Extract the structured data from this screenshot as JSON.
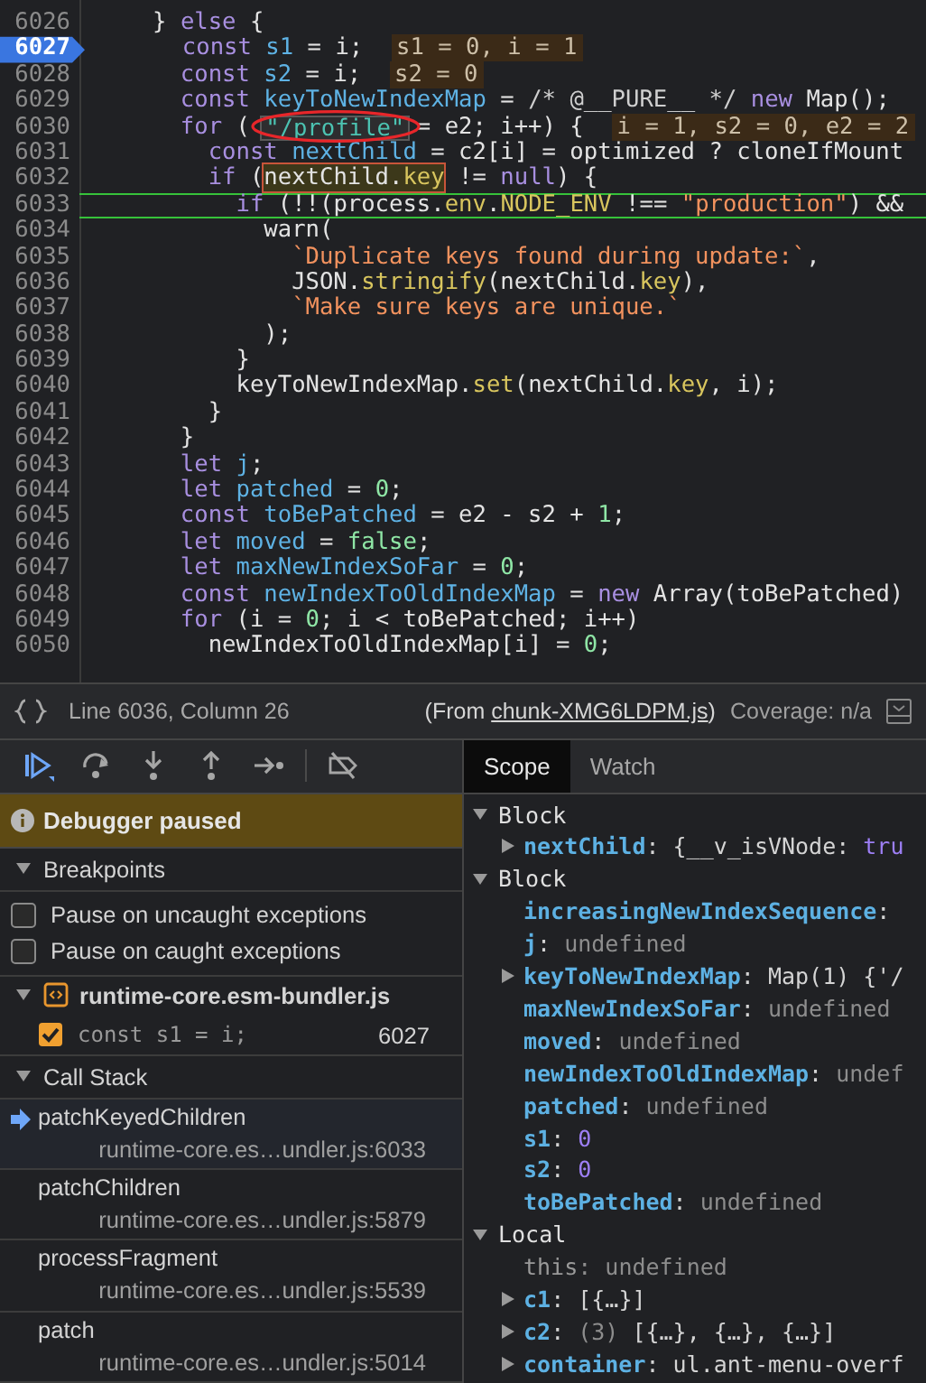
{
  "editor": {
    "lines": [
      {
        "number": "6026",
        "breakpoint": false,
        "current": false,
        "tokens": [
          {
            "text": "     } ",
            "kind": "plain"
          },
          {
            "text": "else",
            "kind": "keyword"
          },
          {
            "text": " {",
            "kind": "plain"
          }
        ]
      },
      {
        "number": "6027",
        "breakpoint": true,
        "current": false,
        "tokens": [
          {
            "text": "       const ",
            "kind": "keyword"
          },
          {
            "text": "s1",
            "kind": "definition"
          },
          {
            "text": " = i;  ",
            "kind": "plain"
          },
          {
            "text": "s1 = 0, i = 1",
            "kind": "inline-value"
          }
        ]
      },
      {
        "number": "6028",
        "breakpoint": false,
        "current": false,
        "tokens": [
          {
            "text": "       const ",
            "kind": "keyword"
          },
          {
            "text": "s2",
            "kind": "definition"
          },
          {
            "text": " = i;  ",
            "kind": "plain"
          },
          {
            "text": "s2 = 0",
            "kind": "inline-value"
          }
        ]
      },
      {
        "number": "6029",
        "breakpoint": false,
        "current": false,
        "tokens": [
          {
            "text": "       const ",
            "kind": "keyword"
          },
          {
            "text": "keyToNewIndexMap",
            "kind": "definition"
          },
          {
            "text": " = ",
            "kind": "plain"
          },
          {
            "text": "/* @__PURE__ */ ",
            "kind": "comment"
          },
          {
            "text": "new",
            "kind": "keyword"
          },
          {
            "text": " Map();",
            "kind": "plain"
          }
        ]
      },
      {
        "number": "6030",
        "breakpoint": false,
        "current": false,
        "tokens": [
          {
            "text": "       for",
            "kind": "keyword"
          },
          {
            "text": " (            = e2; i++) {  ",
            "kind": "plain"
          },
          {
            "text": "i = 1, s2 = 0, e2 = 2",
            "kind": "inline-value"
          }
        ]
      },
      {
        "number": "6031",
        "breakpoint": false,
        "current": false,
        "tokens": [
          {
            "text": "         const ",
            "kind": "keyword"
          },
          {
            "text": "nextChild",
            "kind": "definition"
          },
          {
            "text": " = c2[i] = optimized ? cloneIfMount",
            "kind": "plain"
          }
        ]
      },
      {
        "number": "6032",
        "breakpoint": false,
        "current": false,
        "tokens": [
          {
            "text": "         if",
            "kind": "keyword"
          },
          {
            "text": " (",
            "kind": "plain"
          },
          {
            "kind": "hover",
            "tokens": [
              {
                "text": "nextChild.",
                "kind": "plain"
              },
              {
                "text": "key",
                "kind": "property"
              }
            ]
          },
          {
            "text": " != ",
            "kind": "plain"
          },
          {
            "text": "null",
            "kind": "keyword"
          },
          {
            "text": ") {",
            "kind": "plain"
          }
        ]
      },
      {
        "number": "6033",
        "breakpoint": false,
        "current": true,
        "tokens": [
          {
            "text": "           if",
            "kind": "keyword"
          },
          {
            "text": " (!!(process.",
            "kind": "plain"
          },
          {
            "text": "env",
            "kind": "property"
          },
          {
            "text": ".",
            "kind": "plain"
          },
          {
            "text": "NODE_ENV",
            "kind": "property"
          },
          {
            "text": " !== ",
            "kind": "plain"
          },
          {
            "text": "\"production\"",
            "kind": "string"
          },
          {
            "text": ") &&",
            "kind": "plain"
          }
        ]
      },
      {
        "number": "6034",
        "breakpoint": false,
        "current": false,
        "tokens": [
          {
            "text": "             warn(",
            "kind": "plain"
          }
        ]
      },
      {
        "number": "6035",
        "breakpoint": false,
        "current": false,
        "tokens": [
          {
            "text": "               `Duplicate keys found during update:`",
            "kind": "string"
          },
          {
            "text": ",",
            "kind": "plain"
          }
        ]
      },
      {
        "number": "6036",
        "breakpoint": false,
        "current": false,
        "tokens": [
          {
            "text": "               JSON.",
            "kind": "plain"
          },
          {
            "text": "stringify",
            "kind": "property"
          },
          {
            "text": "(nextChild.",
            "kind": "plain"
          },
          {
            "text": "key",
            "kind": "property"
          },
          {
            "text": "),",
            "kind": "plain"
          }
        ]
      },
      {
        "number": "6037",
        "breakpoint": false,
        "current": false,
        "tokens": [
          {
            "text": "               `Make sure keys are unique.`",
            "kind": "string"
          }
        ]
      },
      {
        "number": "6038",
        "breakpoint": false,
        "current": false,
        "tokens": [
          {
            "text": "             );",
            "kind": "plain"
          }
        ]
      },
      {
        "number": "6039",
        "breakpoint": false,
        "current": false,
        "tokens": [
          {
            "text": "           }",
            "kind": "plain"
          }
        ]
      },
      {
        "number": "6040",
        "breakpoint": false,
        "current": false,
        "tokens": [
          {
            "text": "           keyToNewIndexMap.",
            "kind": "plain"
          },
          {
            "text": "set",
            "kind": "property"
          },
          {
            "text": "(nextChild.",
            "kind": "plain"
          },
          {
            "text": "key",
            "kind": "property"
          },
          {
            "text": ", i);",
            "kind": "plain"
          }
        ]
      },
      {
        "number": "6041",
        "breakpoint": false,
        "current": false,
        "tokens": [
          {
            "text": "         }",
            "kind": "plain"
          }
        ]
      },
      {
        "number": "6042",
        "breakpoint": false,
        "current": false,
        "tokens": [
          {
            "text": "       }",
            "kind": "plain"
          }
        ]
      },
      {
        "number": "6043",
        "breakpoint": false,
        "current": false,
        "tokens": [
          {
            "text": "       let ",
            "kind": "keyword"
          },
          {
            "text": "j",
            "kind": "definition"
          },
          {
            "text": ";",
            "kind": "plain"
          }
        ]
      },
      {
        "number": "6044",
        "breakpoint": false,
        "current": false,
        "tokens": [
          {
            "text": "       let ",
            "kind": "keyword"
          },
          {
            "text": "patched",
            "kind": "definition"
          },
          {
            "text": " = ",
            "kind": "plain"
          },
          {
            "text": "0",
            "kind": "number"
          },
          {
            "text": ";",
            "kind": "plain"
          }
        ]
      },
      {
        "number": "6045",
        "breakpoint": false,
        "current": false,
        "tokens": [
          {
            "text": "       const ",
            "kind": "keyword"
          },
          {
            "text": "toBePatched",
            "kind": "definition"
          },
          {
            "text": " = e2 - s2 + ",
            "kind": "plain"
          },
          {
            "text": "1",
            "kind": "number"
          },
          {
            "text": ";",
            "kind": "plain"
          }
        ]
      },
      {
        "number": "6046",
        "breakpoint": false,
        "current": false,
        "tokens": [
          {
            "text": "       let ",
            "kind": "keyword"
          },
          {
            "text": "moved",
            "kind": "definition"
          },
          {
            "text": " = ",
            "kind": "plain"
          },
          {
            "text": "false",
            "kind": "number"
          },
          {
            "text": ";",
            "kind": "plain"
          }
        ]
      },
      {
        "number": "6047",
        "breakpoint": false,
        "current": false,
        "tokens": [
          {
            "text": "       let ",
            "kind": "keyword"
          },
          {
            "text": "maxNewIndexSoFar",
            "kind": "definition"
          },
          {
            "text": " = ",
            "kind": "plain"
          },
          {
            "text": "0",
            "kind": "number"
          },
          {
            "text": ";",
            "kind": "plain"
          }
        ]
      },
      {
        "number": "6048",
        "breakpoint": false,
        "current": false,
        "tokens": [
          {
            "text": "       const ",
            "kind": "keyword"
          },
          {
            "text": "newIndexToOldIndexMap",
            "kind": "definition"
          },
          {
            "text": " = ",
            "kind": "plain"
          },
          {
            "text": "new",
            "kind": "keyword"
          },
          {
            "text": " Array(toBePatched)",
            "kind": "plain"
          }
        ]
      },
      {
        "number": "6049",
        "breakpoint": false,
        "current": false,
        "tokens": [
          {
            "text": "       for",
            "kind": "keyword"
          },
          {
            "text": " (i = ",
            "kind": "plain"
          },
          {
            "text": "0",
            "kind": "number"
          },
          {
            "text": "; i < toBePatched; i++)",
            "kind": "plain"
          }
        ]
      },
      {
        "number": "6050",
        "breakpoint": false,
        "current": false,
        "tokens": [
          {
            "text": "         newIndexToOldIndexMap[i] = ",
            "kind": "plain"
          },
          {
            "text": "0",
            "kind": "number"
          },
          {
            "text": ";",
            "kind": "plain"
          }
        ]
      }
    ],
    "tooltip": {
      "text": "\"/profile\""
    }
  },
  "status_bar": {
    "position": "Line 6036, Column 26",
    "source_before": "(From ",
    "source_link": "chunk-XMG6LDPM.js",
    "source_after": ")",
    "coverage": "Coverage: n/a"
  },
  "paused_banner": "Debugger paused",
  "breakpoints": {
    "title": "Breakpoints",
    "expanded": true,
    "options": [
      {
        "label": "Pause on uncaught exceptions",
        "checked": false
      },
      {
        "label": "Pause on caught exceptions",
        "checked": false
      }
    ],
    "files": [
      {
        "name": "runtime-core.esm-bundler.js",
        "expanded": true,
        "breakpoints": [
          {
            "code": "const s1 = i;",
            "line": "6027",
            "checked": true
          }
        ]
      }
    ]
  },
  "call_stack": {
    "title": "Call Stack",
    "expanded": true,
    "frames": [
      {
        "name": "patchKeyedChildren",
        "location": "runtime-core.es…undler.js:6033",
        "selected": true
      },
      {
        "name": "patchChildren",
        "location": "runtime-core.es…undler.js:5879",
        "selected": false
      },
      {
        "name": "processFragment",
        "location": "runtime-core.es…undler.js:5539",
        "selected": false
      },
      {
        "name": "patch",
        "location": "runtime-core.es…undler.js:5014",
        "selected": false
      }
    ]
  },
  "sidebar_tabs": [
    {
      "label": "Scope",
      "selected": true
    },
    {
      "label": "Watch",
      "selected": false
    }
  ],
  "scope": [
    {
      "title": "Block",
      "expanded": true,
      "children": [
        {
          "name": "nextChild",
          "expandable": true,
          "dimmed": false,
          "value": [
            {
              "text": ": {__v_isVNode: ",
              "kind": "plain"
            },
            {
              "text": "tru",
              "kind": "literal"
            }
          ]
        }
      ]
    },
    {
      "title": "Block",
      "expanded": true,
      "children": [
        {
          "name": "increasingNewIndexSequence",
          "expandable": false,
          "dimmed": false,
          "value": [
            {
              "text": ":",
              "kind": "plain"
            }
          ]
        },
        {
          "name": "j",
          "expandable": false,
          "dimmed": false,
          "value": [
            {
              "text": ": ",
              "kind": "plain"
            },
            {
              "text": "undefined",
              "kind": "muted"
            }
          ]
        },
        {
          "name": "keyToNewIndexMap",
          "expandable": true,
          "dimmed": false,
          "value": [
            {
              "text": ": Map(1) {'/",
              "kind": "plain"
            }
          ]
        },
        {
          "name": "maxNewIndexSoFar",
          "expandable": false,
          "dimmed": false,
          "value": [
            {
              "text": ": ",
              "kind": "plain"
            },
            {
              "text": "undefined",
              "kind": "muted"
            }
          ]
        },
        {
          "name": "moved",
          "expandable": false,
          "dimmed": false,
          "value": [
            {
              "text": ": ",
              "kind": "plain"
            },
            {
              "text": "undefined",
              "kind": "muted"
            }
          ]
        },
        {
          "name": "newIndexToOldIndexMap",
          "expandable": false,
          "dimmed": false,
          "value": [
            {
              "text": ": ",
              "kind": "plain"
            },
            {
              "text": "undef",
              "kind": "muted"
            }
          ]
        },
        {
          "name": "patched",
          "expandable": false,
          "dimmed": false,
          "value": [
            {
              "text": ": ",
              "kind": "plain"
            },
            {
              "text": "undefined",
              "kind": "muted"
            }
          ]
        },
        {
          "name": "s1",
          "expandable": false,
          "dimmed": false,
          "value": [
            {
              "text": ": ",
              "kind": "plain"
            },
            {
              "text": "0",
              "kind": "literal"
            }
          ]
        },
        {
          "name": "s2",
          "expandable": false,
          "dimmed": false,
          "value": [
            {
              "text": ": ",
              "kind": "plain"
            },
            {
              "text": "0",
              "kind": "literal"
            }
          ]
        },
        {
          "name": "toBePatched",
          "expandable": false,
          "dimmed": false,
          "value": [
            {
              "text": ": ",
              "kind": "plain"
            },
            {
              "text": "undefined",
              "kind": "muted"
            }
          ]
        }
      ]
    },
    {
      "title": "Local",
      "expanded": true,
      "children": [
        {
          "name": "this",
          "expandable": false,
          "dimmed": true,
          "value": [
            {
              "text": ": ",
              "kind": "muted"
            },
            {
              "text": "undefined",
              "kind": "muted"
            }
          ]
        },
        {
          "name": "c1",
          "expandable": true,
          "dimmed": false,
          "value": [
            {
              "text": ": [{…}]",
              "kind": "plain"
            }
          ]
        },
        {
          "name": "c2",
          "expandable": true,
          "dimmed": false,
          "value": [
            {
              "text": ": ",
              "kind": "plain"
            },
            {
              "text": "(3)",
              "kind": "muted"
            },
            {
              "text": " [{…}, {…}, {…}]",
              "kind": "plain"
            }
          ]
        },
        {
          "name": "container",
          "expandable": true,
          "dimmed": false,
          "value": [
            {
              "text": ": ul.ant-menu-overf",
              "kind": "plain"
            }
          ]
        }
      ]
    }
  ]
}
